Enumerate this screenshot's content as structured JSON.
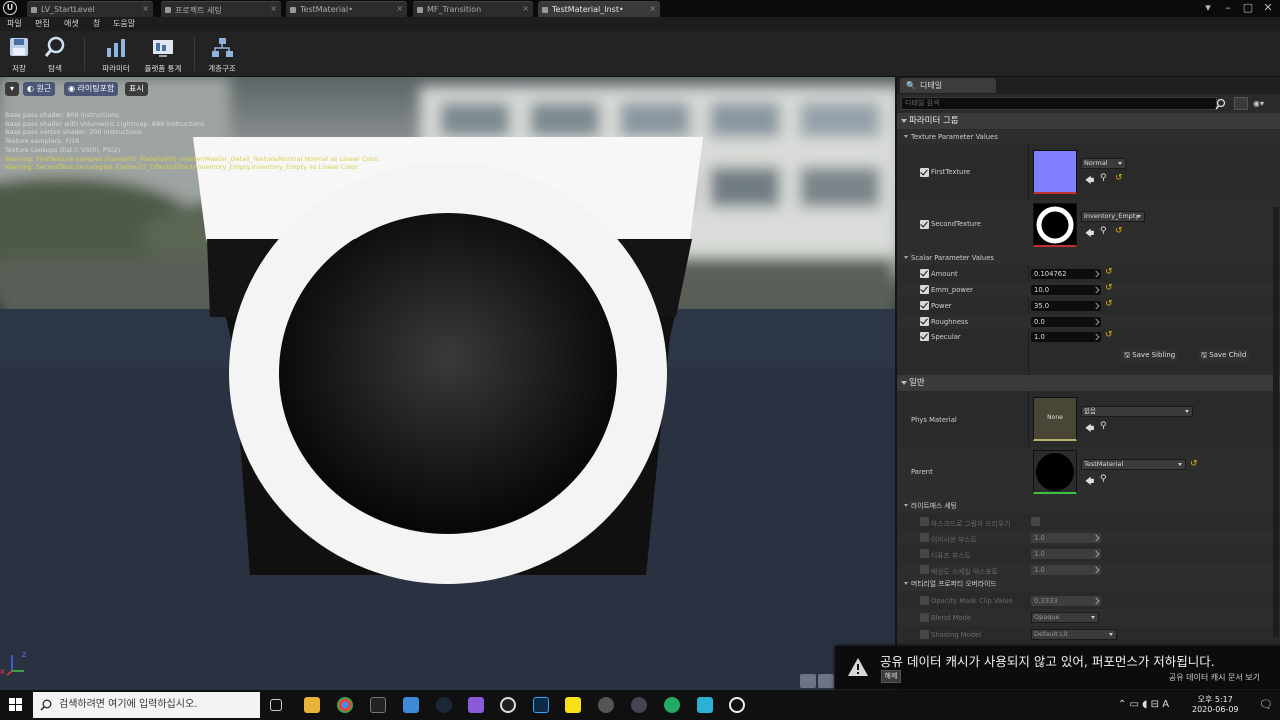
{
  "tabs": [
    {
      "label": "LV_StartLevel",
      "active": false
    },
    {
      "label": "프로젝트 세팅",
      "active": false
    },
    {
      "label": "TestMaterial•",
      "active": false
    },
    {
      "label": "MF_Transition",
      "active": false
    },
    {
      "label": "TestMaterial_Inst•",
      "active": true
    }
  ],
  "menu": [
    "파일",
    "편집",
    "애셋",
    "창",
    "도움말"
  ],
  "toolbar": {
    "save": "저장",
    "browse": "탐색",
    "params": "파라미터",
    "platform": "플랫폼 통계",
    "hierarchy": "계층구조"
  },
  "viewport": {
    "btn_perspective": "원근",
    "btn_lit": "라이팅포함",
    "btn_show": "표시",
    "stats": [
      "Base pass shader: 809 instructions",
      "Base pass shader with Volumetric Lightmap: 880 instructions",
      "Base pass vertex shader: 200 instructions",
      "Texture samplers: 7/16",
      "Texture Lookups (Est.): VS(0), PS(2)"
    ],
    "warnings": [
      "Warning: FirstTexture samples /Game/00_Material/00_master/Master_Detail_Texture/Normal.Normal as Linear Color.",
      "Warning: SecondTexture samples /Game/07_Effects/Effect/Inventory_Empty.Inventory_Empty as Linear Color."
    ],
    "axis_x": "x",
    "axis_z": "z"
  },
  "details": {
    "tab": "디테일",
    "search_placeholder": "디테일 검색",
    "param_group": "파라미터 그룹",
    "texture_params": "Texture Parameter Values",
    "first_texture": {
      "name": "FirstTexture",
      "value": "Normal"
    },
    "second_texture": {
      "name": "SecondTexture",
      "value": "Inventory_Empty"
    },
    "scalar_params": "Scalar Parameter Values",
    "scalars": [
      {
        "name": "Amount",
        "value": "0.104762"
      },
      {
        "name": "Emm_power",
        "value": "10.0"
      },
      {
        "name": "Power",
        "value": "35.0"
      },
      {
        "name": "Roughness",
        "value": "0.0"
      },
      {
        "name": "Specular",
        "value": "1.0"
      }
    ],
    "save_sibling": "Save Sibling",
    "save_child": "Save Child",
    "general": "일반",
    "phys_material": {
      "name": "Phys Material",
      "thumb": "None",
      "value": "없음"
    },
    "parent": {
      "name": "Parent",
      "value": "TestMaterial"
    },
    "lightmass": "라이트매스 세팅",
    "lightmass_rows": [
      {
        "name": "마스크드로 그림자 드리우기",
        "value": ""
      },
      {
        "name": "이미시브 부스트",
        "value": "1.0"
      },
      {
        "name": "디퓨즈 부스트",
        "value": "1.0"
      },
      {
        "name": "배상도 스케일 익스포트",
        "value": "1.0"
      }
    ],
    "overrides": "머티리얼 프로퍼티 오버라이드",
    "override_rows": [
      {
        "name": "Opacity Mask Clip Value",
        "value": "0.3333"
      },
      {
        "name": "Blend Mode",
        "value": "Opaque"
      },
      {
        "name": "Shading Model",
        "value": "Default Lit"
      }
    ]
  },
  "notification": {
    "message": "공유 데이터 캐시가 사용되지 않고 있어, 퍼포먼스가 저하됩니다.",
    "dismiss": "해제",
    "link": "공유 데이터 캐시 문서 보기"
  },
  "taskbar": {
    "search": "검색하려면 여기에 입력하십시오.",
    "time": "오후 5:17",
    "date": "2020-06-09"
  },
  "colors": {
    "accent_yellow": "#e2b400",
    "ui_dark": "#2a2a2a",
    "normal_map": "#8080ff"
  }
}
